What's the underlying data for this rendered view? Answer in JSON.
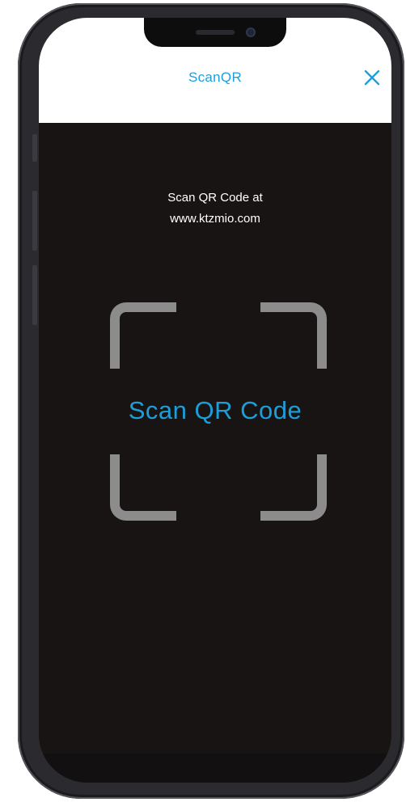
{
  "header": {
    "title": "ScanQR",
    "close_icon": "close-icon"
  },
  "scanner": {
    "instruction_line1": "Scan QR Code at",
    "instruction_line2": "www.ktzmio.com",
    "frame_label": "Scan QR Code"
  },
  "colors": {
    "accent": "#1c9fd9",
    "camera_bg": "#181414",
    "frame": "#8c8c8c",
    "header_bg": "#ffffff"
  }
}
